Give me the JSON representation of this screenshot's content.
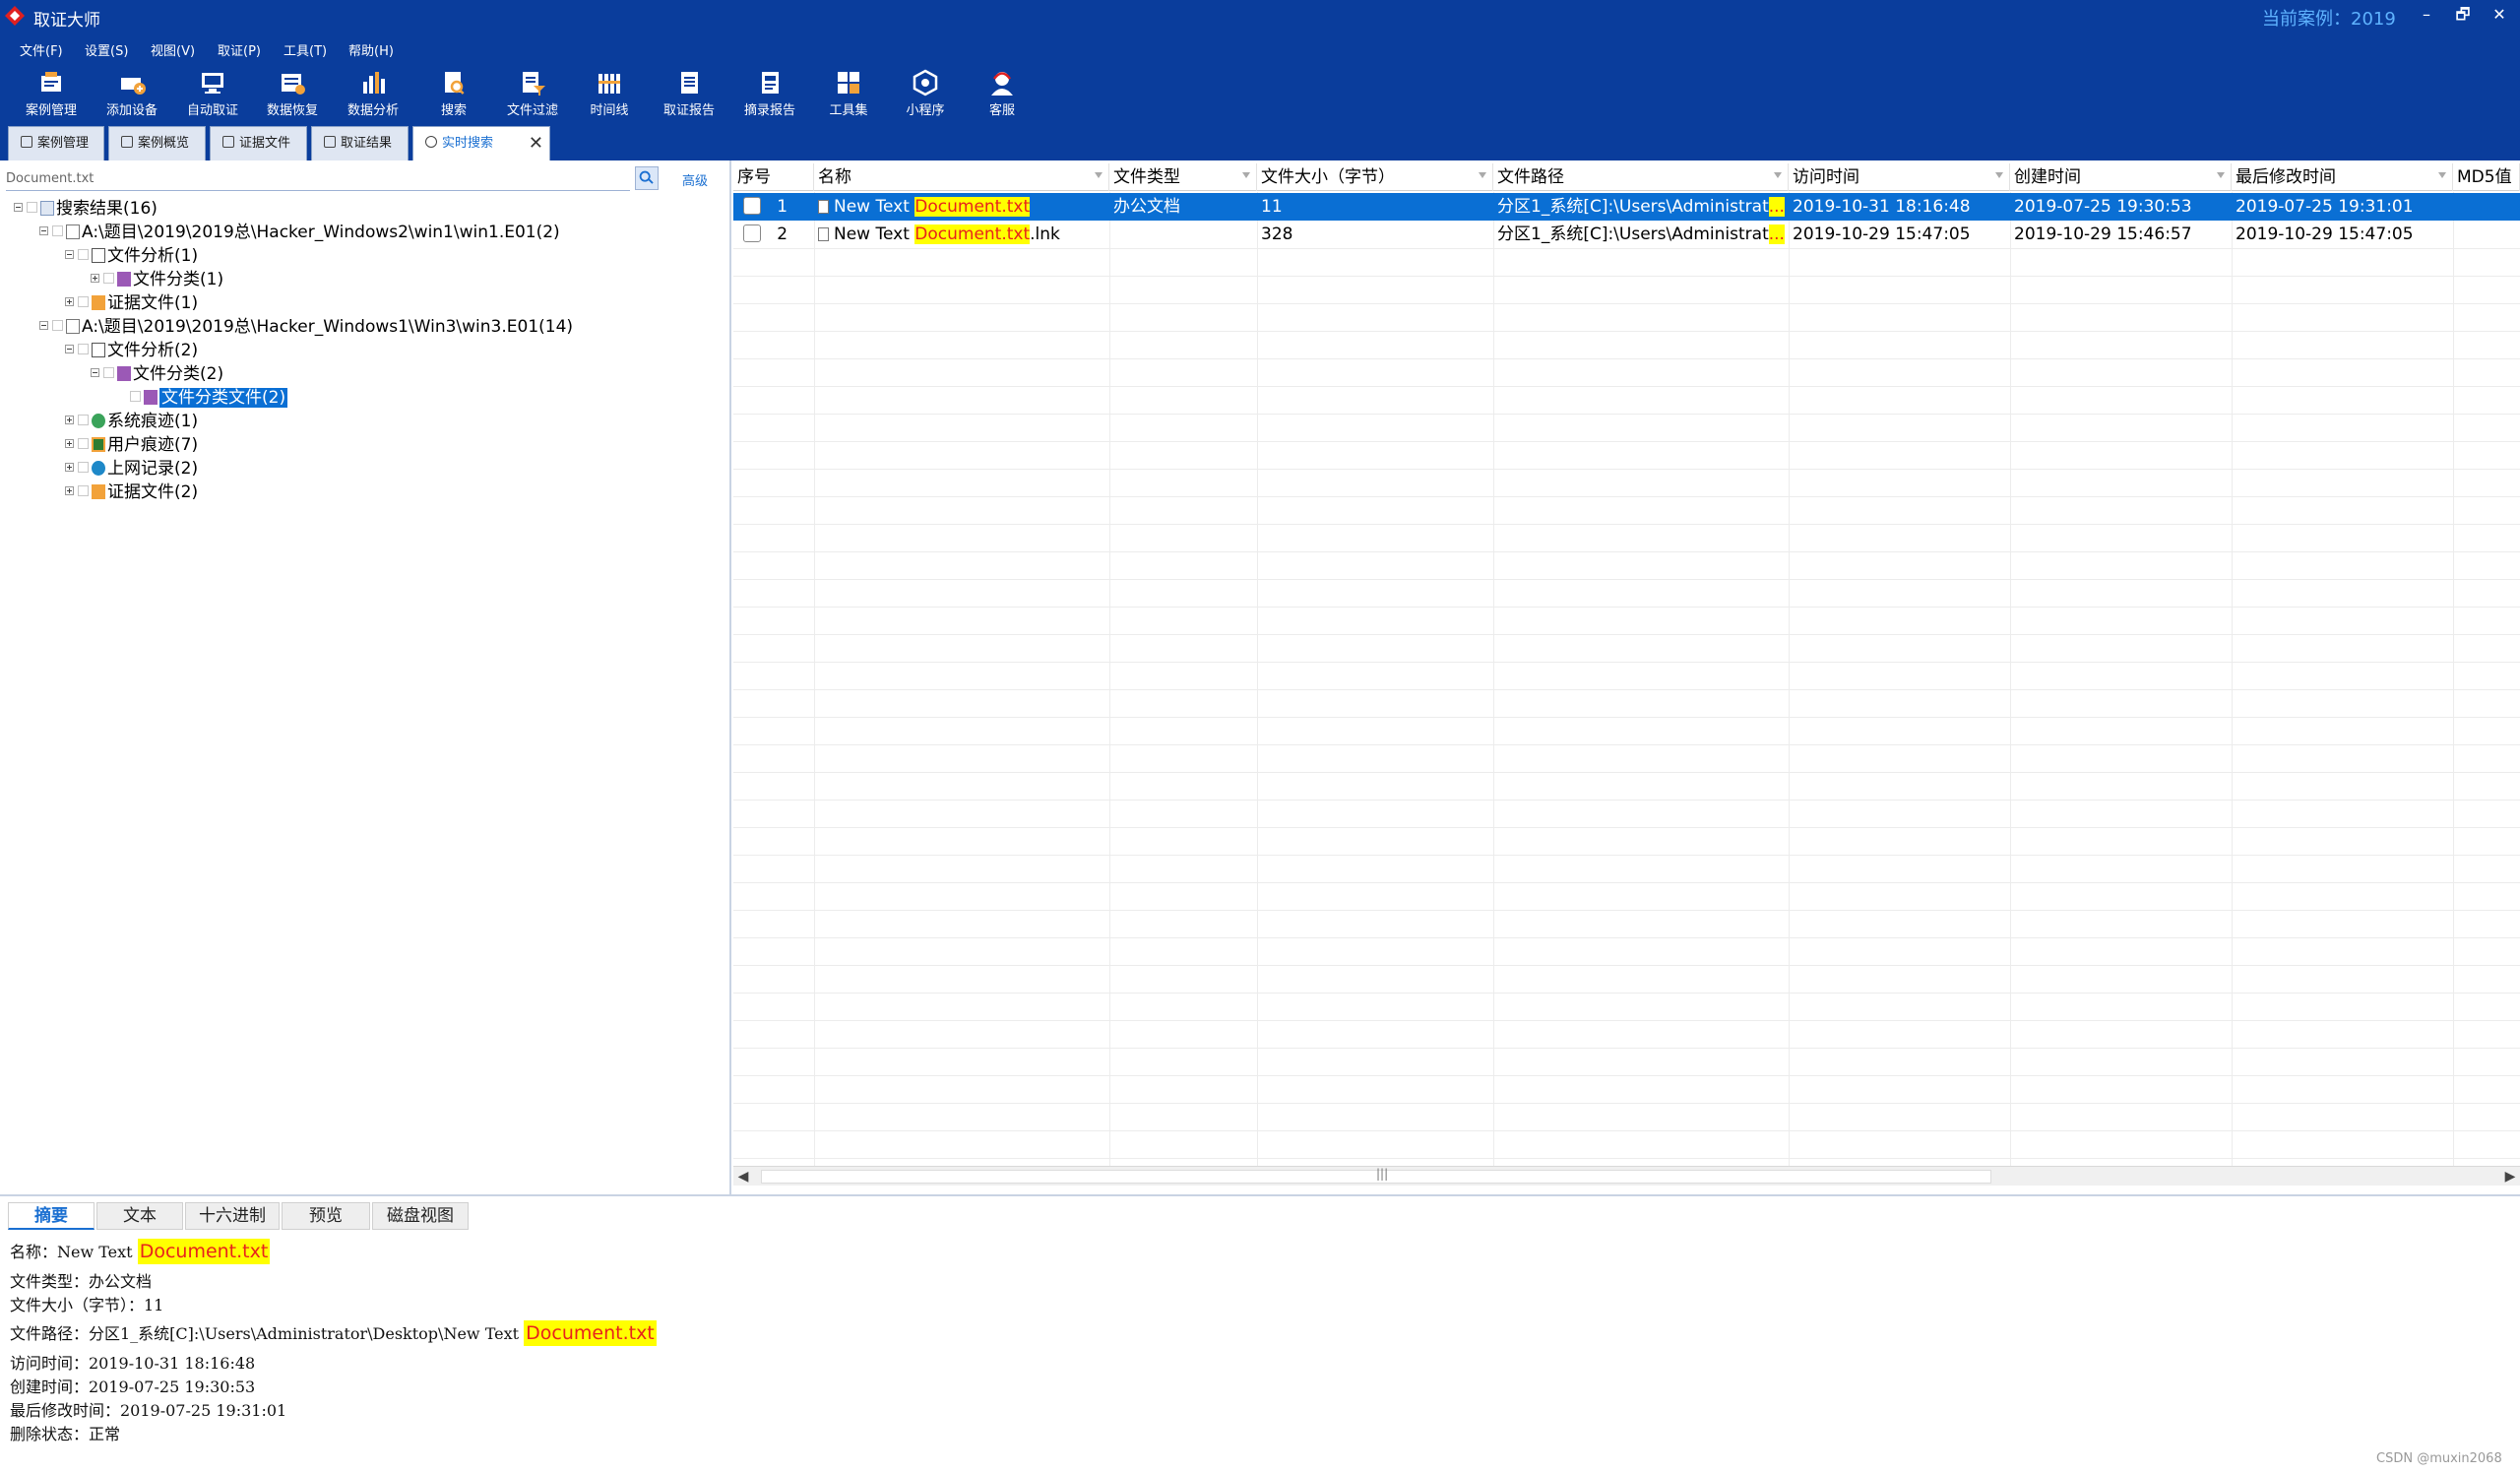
{
  "app": {
    "title": "取证大师",
    "current_case": "当前案例：2019",
    "window_buttons": [
      "–",
      "🗗",
      "✕"
    ]
  },
  "menu": [
    "文件(F)",
    "设置(S)",
    "视图(V)",
    "取证(P)",
    "工具(T)",
    "帮助(H)"
  ],
  "toolbar": [
    {
      "label": "案例管理",
      "icon": "case-manage-icon"
    },
    {
      "label": "添加设备",
      "icon": "add-device-icon"
    },
    {
      "label": "自动取证",
      "icon": "auto-forensics-icon"
    },
    {
      "label": "数据恢复",
      "icon": "data-recovery-icon"
    },
    {
      "label": "数据分析",
      "icon": "data-analysis-icon"
    },
    {
      "label": "搜索",
      "icon": "search-icon"
    },
    {
      "label": "文件过滤",
      "icon": "file-filter-icon"
    },
    {
      "label": "时间线",
      "icon": "timeline-icon"
    },
    {
      "label": "取证报告",
      "icon": "forensics-report-icon"
    },
    {
      "label": "摘录报告",
      "icon": "excerpt-report-icon"
    },
    {
      "label": "工具集",
      "icon": "toolset-icon"
    },
    {
      "label": "小程序",
      "icon": "mini-program-icon"
    },
    {
      "label": "客服",
      "icon": "customer-service-icon"
    }
  ],
  "tabs": [
    {
      "label": "案例管理"
    },
    {
      "label": "案例概览"
    },
    {
      "label": "证据文件"
    },
    {
      "label": "取证结果"
    },
    {
      "label": "实时搜索",
      "active": true
    }
  ],
  "search": {
    "value": "Document.txt",
    "advanced_label": "高级"
  },
  "tree": [
    {
      "label": "搜索结果(16)"
    },
    {
      "label": "A:\\题目\\2019\\2019总\\Hacker_Windows2\\win1\\win1.E01(2)"
    },
    {
      "label": "文件分析(1)"
    },
    {
      "label": "文件分类(1)"
    },
    {
      "label": "证据文件(1)"
    },
    {
      "label": "A:\\题目\\2019\\2019总\\Hacker_Windows1\\Win3\\win3.E01(14)"
    },
    {
      "label": "文件分析(2)"
    },
    {
      "label": "文件分类(2)"
    },
    {
      "label": "文件分类文件(2)"
    },
    {
      "label": "系统痕迹(1)"
    },
    {
      "label": "用户痕迹(7)"
    },
    {
      "label": "上网记录(2)"
    },
    {
      "label": "证据文件(2)"
    }
  ],
  "grid": {
    "columns": [
      "序号",
      "名称",
      "文件类型",
      "文件大小（字节）",
      "文件路径",
      "访问时间",
      "创建时间",
      "最后修改时间",
      "MD5值"
    ],
    "rows": [
      {
        "index": "1",
        "name_prefix": "New Text ",
        "name_match": "Document.txt",
        "name_suffix": "",
        "type": "办公文档",
        "size": "11",
        "path": "分区1_系统[C]:\\Users\\Administrat",
        "path_more": "...",
        "access": "2019-10-31 18:16:48",
        "created": "2019-07-25 19:30:53",
        "modified": "2019-07-25 19:31:01",
        "selected": true
      },
      {
        "index": "2",
        "name_prefix": "New Text ",
        "name_match": "Document.txt",
        "name_suffix": ".lnk",
        "type": "",
        "size": "328",
        "path": "分区1_系统[C]:\\Users\\Administrat",
        "path_more": "...",
        "access": "2019-10-29 15:47:05",
        "created": "2019-10-29 15:46:57",
        "modified": "2019-10-29 15:47:05",
        "selected": false
      }
    ],
    "scroll_grip": "|||"
  },
  "bottom_tabs": [
    "摘要",
    "文本",
    "十六进制",
    "预览",
    "磁盘视图"
  ],
  "details": {
    "name_label": "名称：New Text ",
    "name_match": "Document.txt",
    "type": "文件类型：办公文档",
    "size": "文件大小（字节）：11",
    "path_label": "文件路径：分区1_系统[C]:\\Users\\Administrator\\Desktop\\New Text ",
    "path_match": "Document.txt",
    "access": "访问时间：2019-10-31 18:16:48",
    "created": "创建时间：2019-07-25 19:30:53",
    "modified": "最后修改时间：2019-07-25 19:31:01",
    "deleted": "删除状态：正常"
  },
  "watermark": "CSDN @muxin2068",
  "colors": {
    "chrome": "#0a3d9c",
    "selection": "#0a6fd4",
    "highlight_bg": "#ffff00",
    "highlight_text": "#e8221c",
    "link": "#1a6fd1"
  }
}
